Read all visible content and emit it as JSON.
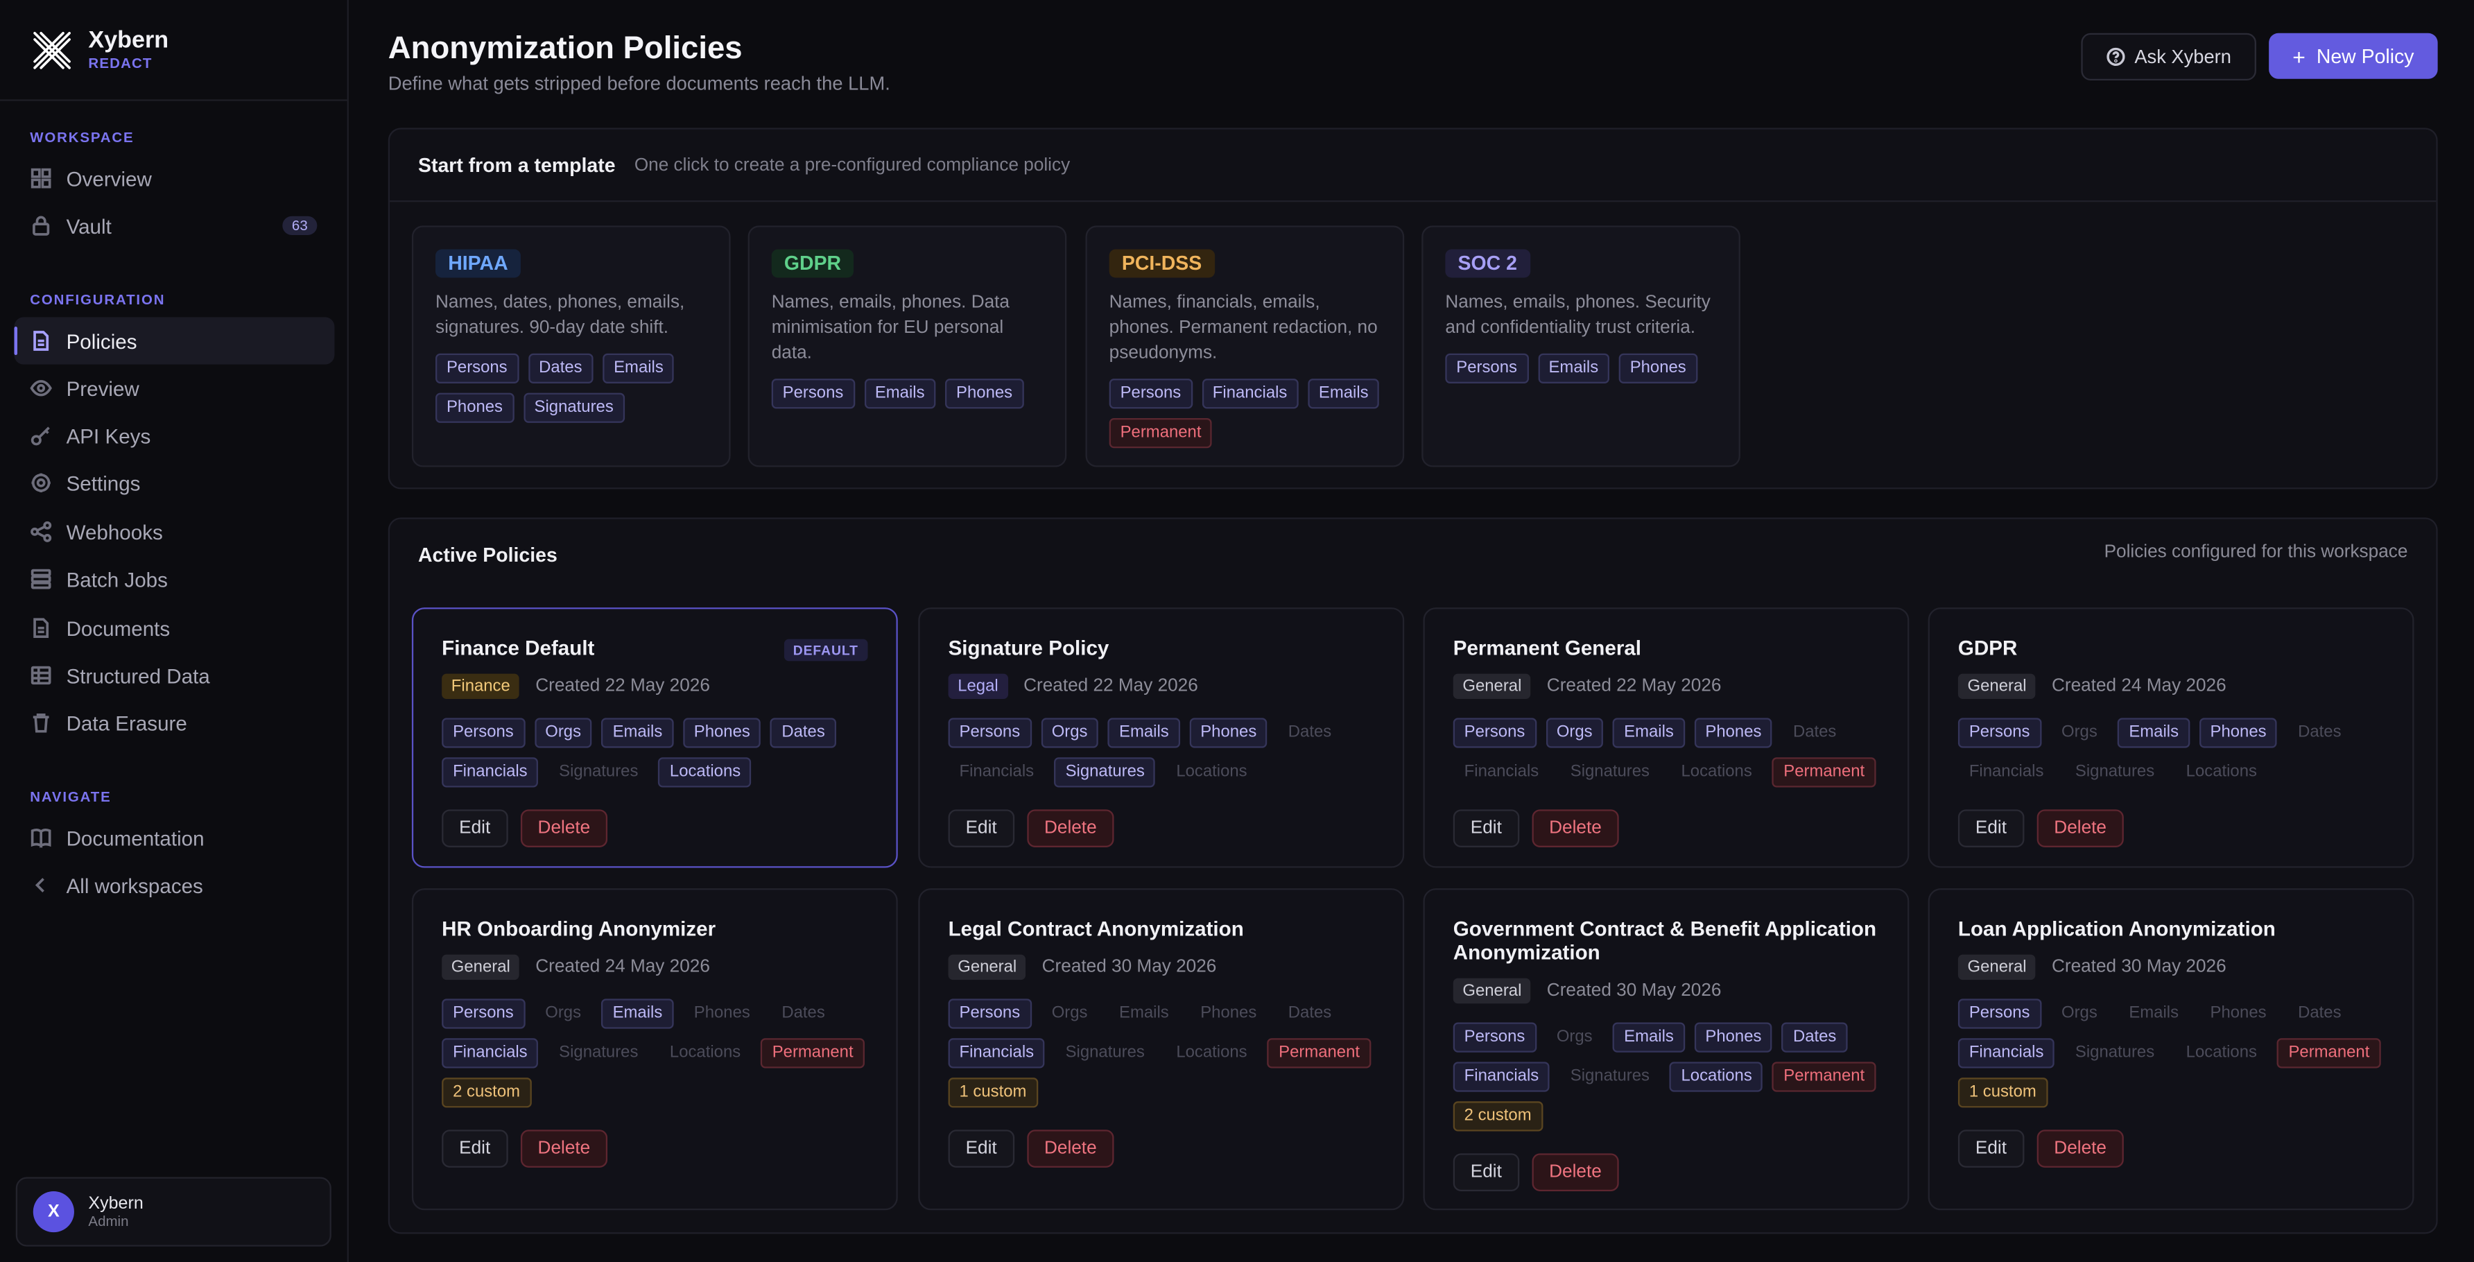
{
  "brand": {
    "name": "Xybern",
    "product": "REDACT"
  },
  "sidebar": {
    "sections": [
      {
        "label": "WORKSPACE",
        "items": [
          {
            "label": "Overview",
            "icon": "grid-icon"
          },
          {
            "label": "Vault",
            "icon": "lock-icon",
            "badge": "63"
          }
        ]
      },
      {
        "label": "CONFIGURATION",
        "items": [
          {
            "label": "Policies",
            "icon": "document-icon",
            "active": true
          },
          {
            "label": "Preview",
            "icon": "eye-icon"
          },
          {
            "label": "API Keys",
            "icon": "key-icon"
          },
          {
            "label": "Settings",
            "icon": "gear-icon"
          },
          {
            "label": "Webhooks",
            "icon": "share-icon"
          },
          {
            "label": "Batch Jobs",
            "icon": "stack-icon"
          },
          {
            "label": "Documents",
            "icon": "file-icon"
          },
          {
            "label": "Structured Data",
            "icon": "table-icon"
          },
          {
            "label": "Data Erasure",
            "icon": "trash-icon"
          }
        ]
      },
      {
        "label": "NAVIGATE",
        "items": [
          {
            "label": "Documentation",
            "icon": "book-icon"
          },
          {
            "label": "All workspaces",
            "icon": "chevron-left-icon"
          }
        ]
      }
    ],
    "user": {
      "initial": "X",
      "name": "Xybern",
      "role": "Admin"
    }
  },
  "header": {
    "title": "Anonymization Policies",
    "subtitle": "Define what gets stripped before documents reach the LLM.",
    "ask_label": "Ask Xybern",
    "new_label": "New Policy"
  },
  "templates": {
    "title": "Start from a template",
    "hint": "One click to create a pre-configured compliance policy",
    "items": [
      {
        "name": "HIPAA",
        "color": "#6fa8ff",
        "bg": "#16233d",
        "desc": "Names, dates, phones, emails, signatures. 90-day date shift.",
        "chips": [
          [
            "Persons",
            "on"
          ],
          [
            "Dates",
            "on"
          ],
          [
            "Emails",
            "on"
          ],
          [
            "Phones",
            "on"
          ],
          [
            "Signatures",
            "on"
          ]
        ]
      },
      {
        "name": "GDPR",
        "color": "#5fd08a",
        "bg": "#13291d",
        "desc": "Names, emails, phones. Data minimisation for EU personal data.",
        "chips": [
          [
            "Persons",
            "on"
          ],
          [
            "Emails",
            "on"
          ],
          [
            "Phones",
            "on"
          ]
        ]
      },
      {
        "name": "PCI-DSS",
        "color": "#f0b45c",
        "bg": "#33250f",
        "desc": "Names, financials, emails, phones. Permanent redaction, no pseudonyms.",
        "chips": [
          [
            "Persons",
            "on"
          ],
          [
            "Financials",
            "on"
          ],
          [
            "Emails",
            "on"
          ],
          [
            "Permanent",
            "perm"
          ]
        ]
      },
      {
        "name": "SOC 2",
        "color": "#a79ff5",
        "bg": "#211f3a",
        "desc": "Names, emails, phones. Security and confidentiality trust criteria.",
        "chips": [
          [
            "Persons",
            "on"
          ],
          [
            "Emails",
            "on"
          ],
          [
            "Phones",
            "on"
          ]
        ]
      }
    ]
  },
  "policies": {
    "title": "Active Policies",
    "hint": "Policies configured for this workspace",
    "edit_label": "Edit",
    "delete_label": "Delete",
    "default_label": "DEFAULT",
    "items": [
      {
        "name": "Finance Default",
        "default": true,
        "category": "Finance",
        "created": "Created 22 May 2026",
        "chips": [
          [
            "Persons",
            "on"
          ],
          [
            "Orgs",
            "on"
          ],
          [
            "Emails",
            "on"
          ],
          [
            "Phones",
            "on"
          ],
          [
            "Dates",
            "on"
          ],
          [
            "Financials",
            "on"
          ],
          [
            "Signatures",
            "off"
          ],
          [
            "Locations",
            "on"
          ]
        ]
      },
      {
        "name": "Signature Policy",
        "category": "Legal",
        "created": "Created 22 May 2026",
        "chips": [
          [
            "Persons",
            "on"
          ],
          [
            "Orgs",
            "on"
          ],
          [
            "Emails",
            "on"
          ],
          [
            "Phones",
            "on"
          ],
          [
            "Dates",
            "off"
          ],
          [
            "Financials",
            "off"
          ],
          [
            "Signatures",
            "on"
          ],
          [
            "Locations",
            "off"
          ]
        ]
      },
      {
        "name": "Permanent General",
        "category": "General",
        "created": "Created 22 May 2026",
        "chips": [
          [
            "Persons",
            "on"
          ],
          [
            "Orgs",
            "on"
          ],
          [
            "Emails",
            "on"
          ],
          [
            "Phones",
            "on"
          ],
          [
            "Dates",
            "off"
          ],
          [
            "Financials",
            "off"
          ],
          [
            "Signatures",
            "off"
          ],
          [
            "Locations",
            "off"
          ],
          [
            "Permanent",
            "perm"
          ]
        ]
      },
      {
        "name": "GDPR",
        "category": "General",
        "created": "Created 24 May 2026",
        "chips": [
          [
            "Persons",
            "on"
          ],
          [
            "Orgs",
            "off"
          ],
          [
            "Emails",
            "on"
          ],
          [
            "Phones",
            "on"
          ],
          [
            "Dates",
            "off"
          ],
          [
            "Financials",
            "off"
          ],
          [
            "Signatures",
            "off"
          ],
          [
            "Locations",
            "off"
          ]
        ]
      },
      {
        "name": "HR Onboarding Anonymizer",
        "category": "General",
        "created": "Created 24 May 2026",
        "chips": [
          [
            "Persons",
            "on"
          ],
          [
            "Orgs",
            "off"
          ],
          [
            "Emails",
            "on"
          ],
          [
            "Phones",
            "off"
          ],
          [
            "Dates",
            "off"
          ],
          [
            "Financials",
            "on"
          ],
          [
            "Signatures",
            "off"
          ],
          [
            "Locations",
            "off"
          ],
          [
            "Permanent",
            "perm"
          ],
          [
            "2 custom",
            "custom"
          ]
        ]
      },
      {
        "name": "Legal Contract Anonymization",
        "category": "General",
        "created": "Created 30 May 2026",
        "chips": [
          [
            "Persons",
            "on"
          ],
          [
            "Orgs",
            "off"
          ],
          [
            "Emails",
            "off"
          ],
          [
            "Phones",
            "off"
          ],
          [
            "Dates",
            "off"
          ],
          [
            "Financials",
            "on"
          ],
          [
            "Signatures",
            "off"
          ],
          [
            "Locations",
            "off"
          ],
          [
            "Permanent",
            "perm"
          ],
          [
            "1 custom",
            "custom"
          ]
        ]
      },
      {
        "name": "Government Contract & Benefit Application Anonymization",
        "category": "General",
        "created": "Created 30 May 2026",
        "chips": [
          [
            "Persons",
            "on"
          ],
          [
            "Orgs",
            "off"
          ],
          [
            "Emails",
            "on"
          ],
          [
            "Phones",
            "on"
          ],
          [
            "Dates",
            "on"
          ],
          [
            "Financials",
            "on"
          ],
          [
            "Signatures",
            "off"
          ],
          [
            "Locations",
            "on"
          ],
          [
            "Permanent",
            "perm"
          ],
          [
            "2 custom",
            "custom"
          ]
        ]
      },
      {
        "name": "Loan Application Anonymization",
        "category": "General",
        "created": "Created 30 May 2026",
        "chips": [
          [
            "Persons",
            "on"
          ],
          [
            "Orgs",
            "off"
          ],
          [
            "Emails",
            "off"
          ],
          [
            "Phones",
            "off"
          ],
          [
            "Dates",
            "off"
          ],
          [
            "Financials",
            "on"
          ],
          [
            "Signatures",
            "off"
          ],
          [
            "Locations",
            "off"
          ],
          [
            "Permanent",
            "perm"
          ],
          [
            "1 custom",
            "custom"
          ]
        ]
      }
    ]
  }
}
